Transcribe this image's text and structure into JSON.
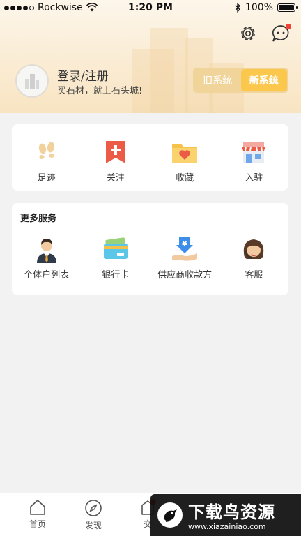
{
  "status_bar": {
    "carrier": "Rockwise",
    "time": "1:20 PM",
    "battery": "100%"
  },
  "header": {
    "login_title": "登录/注册",
    "login_subtitle": "买石材，就上石头城!",
    "switch": {
      "old_label": "旧系统",
      "new_label": "新系统",
      "selected": "新系统"
    }
  },
  "quick_actions": [
    {
      "label": "足迹",
      "icon": "footprints-icon"
    },
    {
      "label": "关注",
      "icon": "bookmark-plus-icon"
    },
    {
      "label": "收藏",
      "icon": "heart-folder-icon"
    },
    {
      "label": "入驻",
      "icon": "storefront-icon"
    }
  ],
  "more_services": {
    "title": "更多服务",
    "items": [
      {
        "label": "个体户列表",
        "icon": "businessman-icon"
      },
      {
        "label": "银行卡",
        "icon": "bank-card-icon"
      },
      {
        "label": "供应商收款方",
        "icon": "yuan-payment-icon"
      },
      {
        "label": "客服",
        "icon": "customer-service-icon"
      }
    ]
  },
  "tabbar": {
    "tabs": [
      {
        "label": "首页",
        "icon": "home-icon"
      },
      {
        "label": "发现",
        "icon": "compass-icon"
      },
      {
        "label": "交",
        "icon": "trade-icon"
      }
    ]
  },
  "watermark": {
    "title": "下载鸟资源",
    "url": "www.xiazainiao.com"
  },
  "colors": {
    "accent": "#fbc74c",
    "badge": "#f04134",
    "header_gradient_end": "#f8e4c2"
  }
}
